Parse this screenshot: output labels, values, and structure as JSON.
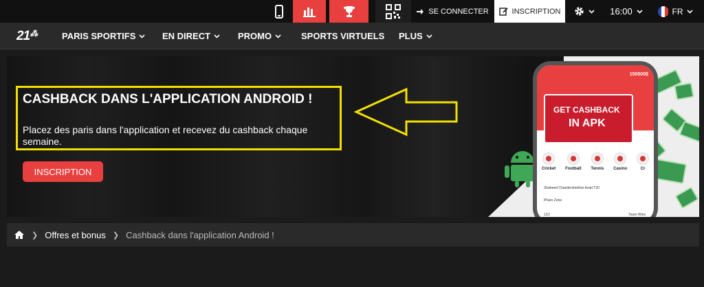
{
  "topbar": {
    "login_label": "SE CONNECTER",
    "signup_label": "INSCRIPTION",
    "time": "16:00",
    "language": "FR"
  },
  "nav": {
    "logo": "21",
    "items": [
      {
        "label": "PARIS SPORTIFS"
      },
      {
        "label": "EN DIRECT"
      },
      {
        "label": "PROMO"
      },
      {
        "label": "SPORTS VIRTUELS"
      },
      {
        "label": "PLUS"
      }
    ]
  },
  "banner": {
    "title": "CASHBACK DANS L'APPLICATION ANDROID !",
    "description": "Placez des paris dans l'application et recevez du cashback chaque semaine.",
    "button_label": "INSCRIPTION",
    "phone": {
      "balance": "150000$",
      "promo_line1": "GET CASHBACK",
      "promo_line2": "IN APK",
      "sports": [
        "Cricket",
        "Football",
        "Tennis",
        "Casino",
        "Cr"
      ],
      "match_a": "Shaheed Chandershekhar Azad T20",
      "match_b": "Pharo Zone",
      "match_c": "1X2",
      "match_d": "Team Wins"
    }
  },
  "breadcrumb": {
    "items": [
      "Offres et bonus",
      "Cashback dans l'application Android !"
    ]
  },
  "colors": {
    "accent": "#e8403f",
    "highlight": "#f4e000",
    "background": "#1b1b1b"
  }
}
